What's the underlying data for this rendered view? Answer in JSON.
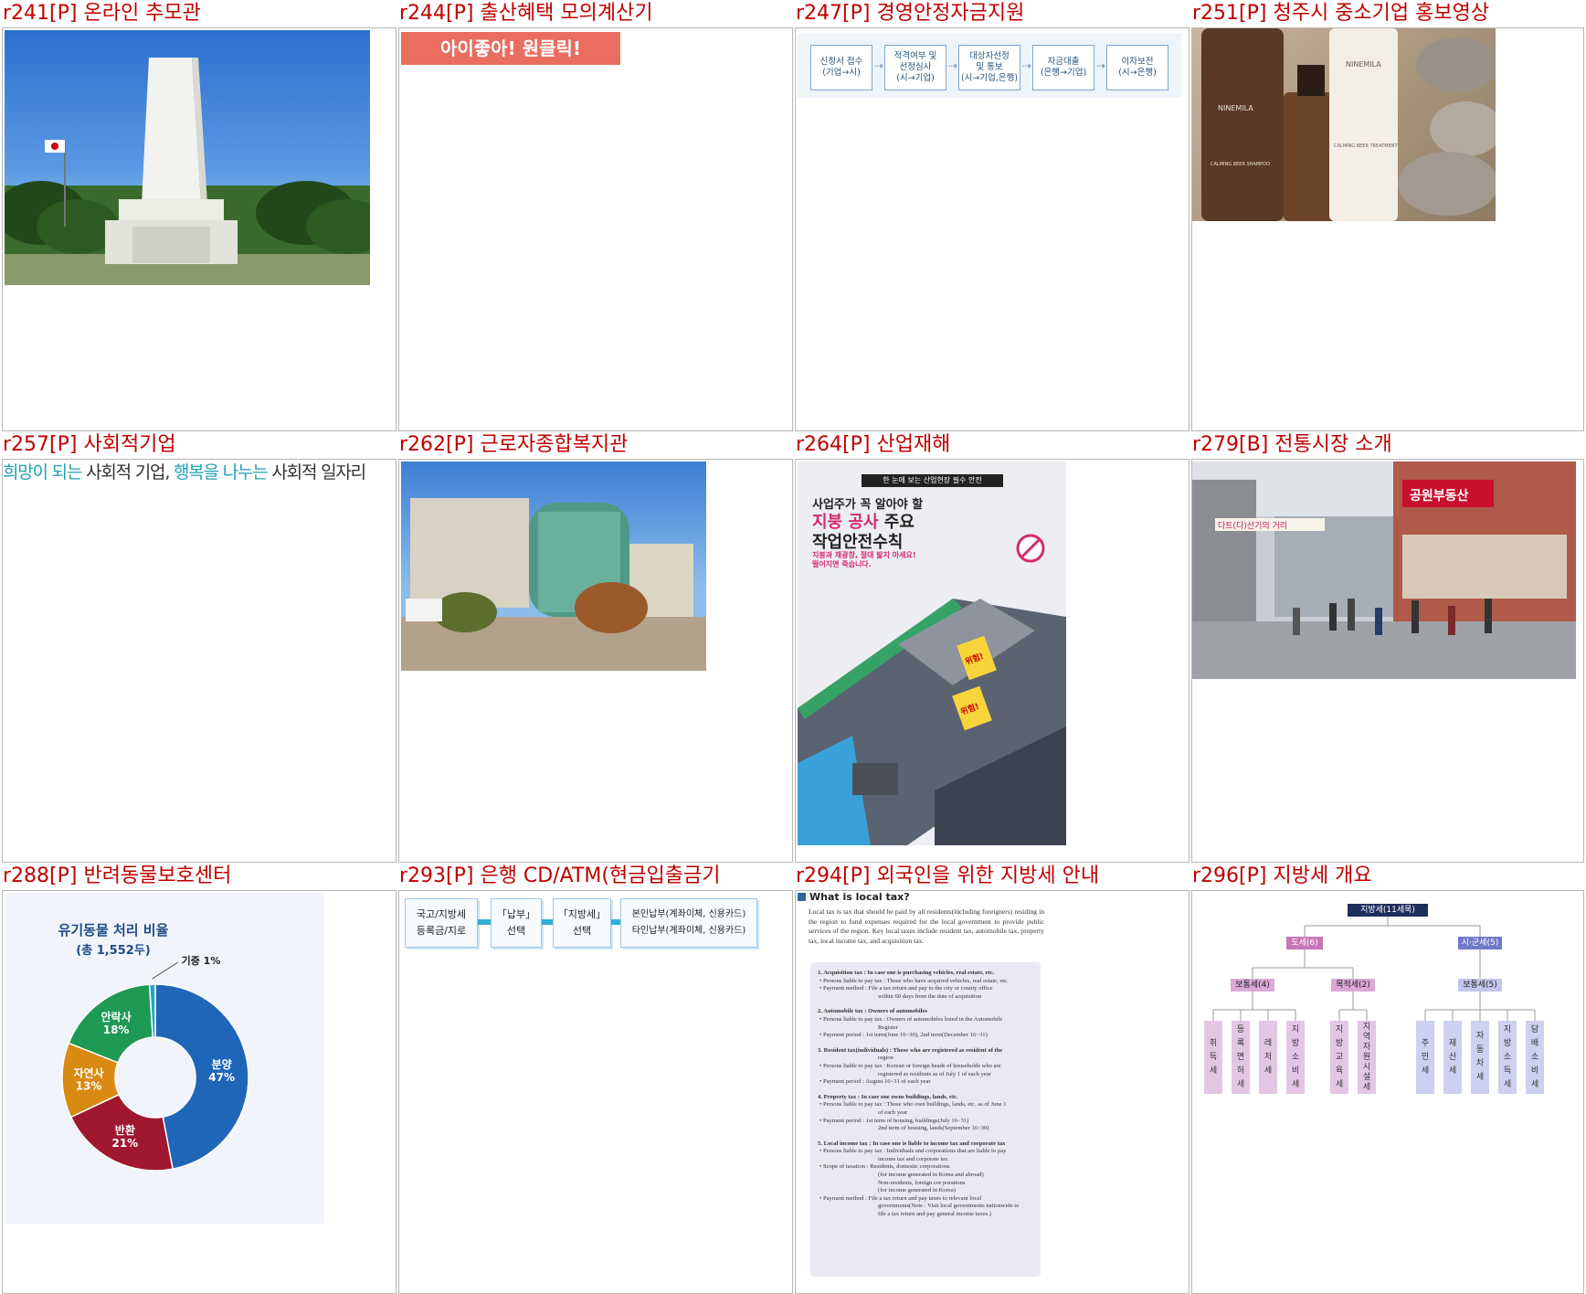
{
  "tiles": [
    {
      "title": "r241[P] 온라인 추모관",
      "image": "memorial-tower-photo"
    },
    {
      "title": "r244[P] 출산혜택 모의계산기",
      "banner": "아이좋아! 원클릭!"
    },
    {
      "title": "r247[P] 경영안정자금지원",
      "steps": [
        "신청서 접수\n(기업→시)",
        "적격여부 및\n선정심사\n(시→기업)",
        "대상자선정\n및 통보\n(시→기업,은행)",
        "자금대출\n(은행→기업)",
        "이차보전\n(시→은행)"
      ]
    },
    {
      "title": "r251[P] 청주시 중소기업 홍보영상",
      "brand": "NINEMILA",
      "products": [
        "CALMING BEER SHAMPOO",
        "CALMING BEER TREATMENT"
      ]
    },
    {
      "title": "r257[P] 사회적기업",
      "tagline_a": "희망이 되는",
      "tagline_b": " 사회적 기업, ",
      "tagline_c": "행복을 나누는",
      "tagline_d": " 사회적 일자리"
    },
    {
      "title": "r262[P] 근로자종합복지관",
      "image": "welfare-center-photo"
    },
    {
      "title": "r264[P] 산업재해",
      "poster_top": "한 눈에 보는 산업현장 필수 안전",
      "poster_l1": "사업주가 꼭 알아야 할",
      "poster_l2a": "지붕 공사",
      "poster_l2b": " 주요",
      "poster_l3": "작업안전수칙",
      "poster_sub": "지붕과 채광창, 절대 밟지 마세요!\n떨어지면 죽습니다.",
      "danger": "위험!"
    },
    {
      "title": "r279[B] 전통시장 소개",
      "sign": "공원부동산",
      "street": "다트(다)선기의 거리"
    },
    {
      "title": "r288[P] 반려동물보호센터"
    },
    {
      "title": "r293[P] 은행 CD/ATM(현금입출금기",
      "steps": [
        "국고/지방세\n등록금/지로",
        "「납부」\n선택",
        "「지방세」\n선택",
        "본인납부(계좌이체, 신용카드)\n타인납부(계좌이체, 신용카드)"
      ]
    },
    {
      "title": "r294[P] 외국인을 위한 지방세 안내",
      "heading": "What is local tax?"
    },
    {
      "title": "r296[P] 지방세 개요"
    }
  ],
  "pet_chart": {
    "title": "유기동물 처리 비율",
    "subtitle": "(총 1,552두)",
    "colors": {
      "분양": "#1f66b9",
      "반환": "#a0182f",
      "자연사": "#d88a12",
      "안락사": "#1e9a55",
      "기증": "#22a6c9"
    }
  },
  "chart_data": {
    "type": "pie",
    "title": "유기동물 처리 비율",
    "subtitle": "(총 1,552두)",
    "categories": [
      "분양",
      "반환",
      "자연사",
      "안락사",
      "기증"
    ],
    "values": [
      47,
      21,
      13,
      18,
      1
    ],
    "labels": [
      "분양\n47%",
      "반환\n21%",
      "자연사\n13%",
      "안락사\n18%",
      "기증 1%"
    ]
  },
  "local_tax": {
    "intro": "Local tax is tax that should be paid by all residents(including foreigners) residing in the region to fund expenses required for the local government to provide public services of the region. Key local taxes include resident tax, automobile tax, property tax, local income tax, and acquisition tax.",
    "sections": [
      {
        "h": "1. Acquisition tax : In case one is purchasing vehicles, real estate, etc.",
        "lines": [
          "• Persons liable to pay tax : Those who have acquired vehicles, real estate, etc.",
          "• Payment method : File a tax return and pay to the city or county office",
          "within 60 days from the date of acquisition"
        ]
      },
      {
        "h": "2. Automobile tax : Owners of automobiles",
        "lines": [
          "• Persons liable to pay tax : Owners of automobiles listed in the Automobile",
          "Register",
          "• Payment period : 1st term(June 16~30), 2nd term(December 16~31)"
        ]
      },
      {
        "h": "3. Resident tax(individuals) : Those who are registered as resident of the",
        "lines": [
          "region",
          "• Persons liable to pay tax : Korean or foreign heads of households who are",
          "registered as residents as of July 1 of each year",
          "• Payment period : August 16~31 of each year"
        ]
      },
      {
        "h": "4. Property tax : In case one owns buildings, lands, etc.",
        "lines": [
          "• Persons liable to pay tax : Those who own buildings, lands, etc. as of June 1",
          "of each year",
          "• Payment period : 1st term of housing, buildings(July 16~31)",
          "2nd term of housing, lands(September 16~30)"
        ]
      },
      {
        "h": "5. Local income tax : In case one is liable to income tax and corporate tax",
        "lines": [
          "• Persons liable to pay tax : Individuals and corporations that are liable to pay",
          "income tax and corporate tax",
          "• Scope of taxation : Residents, domestic corporations",
          "(for income generated in Korea and abroad)",
          "Non-residents, foreign cor porations",
          "(for income generated in Korea)",
          "• Payment method : File a tax return and pay taxes to relevant local",
          "governments(Note : Visit local governments nationwide to",
          "file a tax return and pay general income taxes.)"
        ]
      }
    ]
  },
  "tax_tree": {
    "root": "지방세(11세목)",
    "prov": "도세(6)",
    "city": "시·군세(5)",
    "prov_ord": "보통세(4)",
    "prov_obj": "목적세(2)",
    "city_ord": "보통세(5)",
    "prov_ord_leaves": [
      "취\n득\n세",
      "등\n록\n면\n허\n세",
      "레\n저\n세",
      "지\n방\n소\n비\n세"
    ],
    "prov_obj_leaves": [
      "지\n방\n교\n육\n세",
      "지\n역\n자\n원\n시\n설\n세"
    ],
    "city_leaves": [
      "주\n민\n세",
      "재\n산\n세",
      "자\n동\n차\n세",
      "지\n방\n소\n득\n세",
      "담\n배\n소\n비\n세"
    ]
  }
}
